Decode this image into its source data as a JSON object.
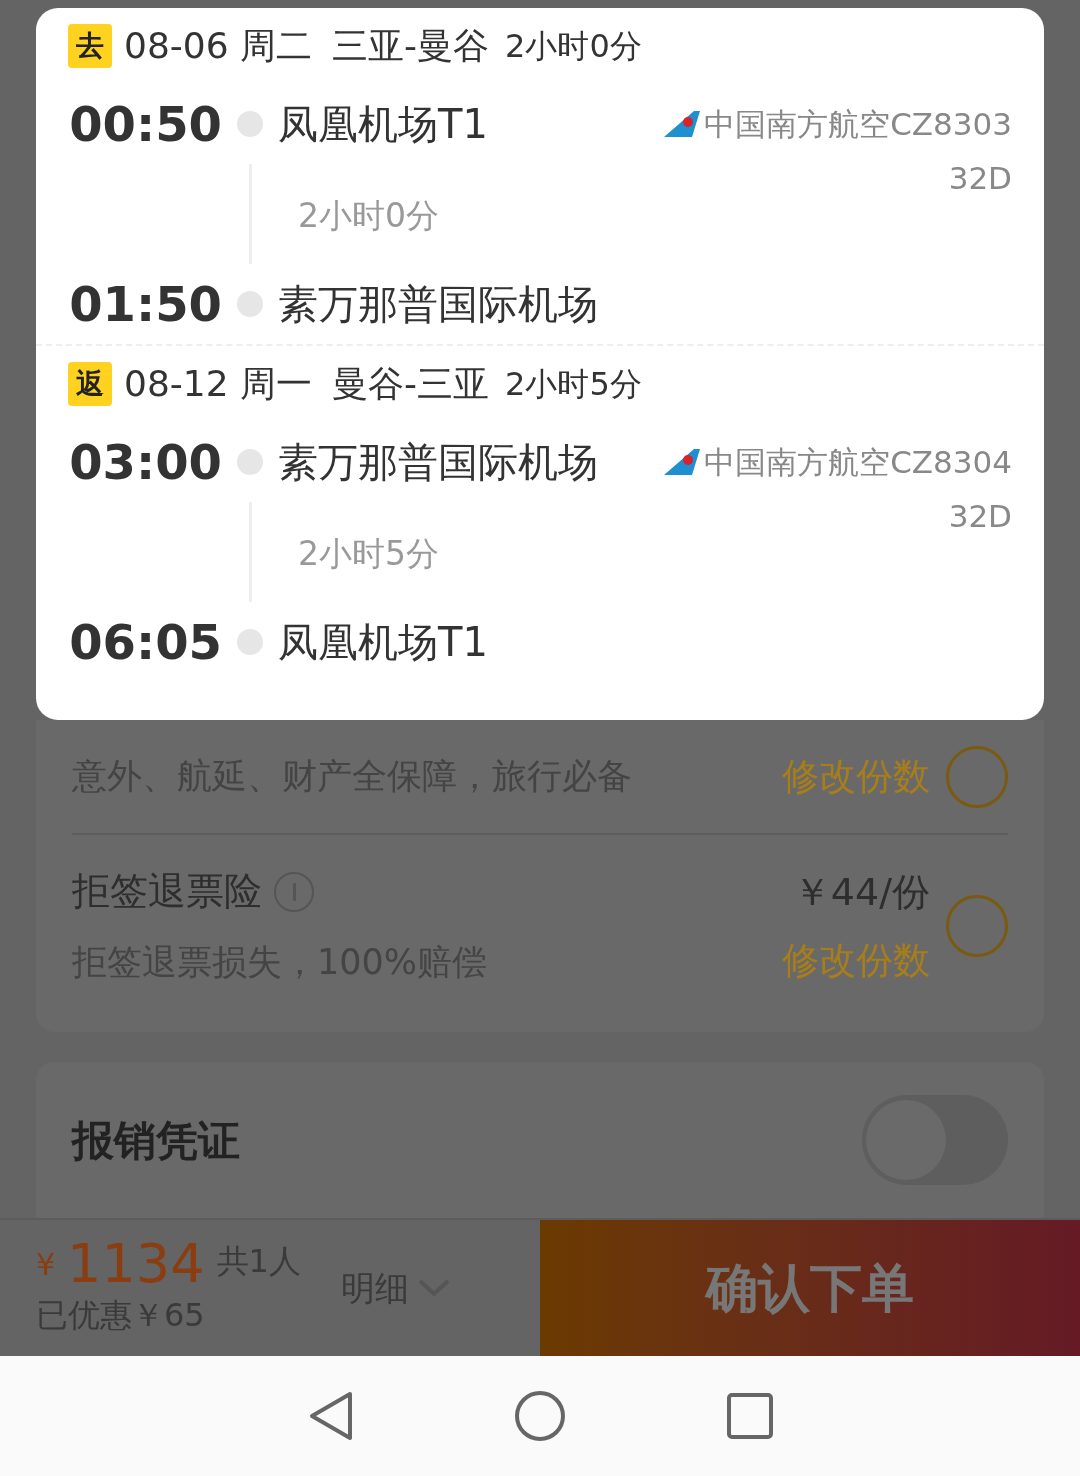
{
  "flights": [
    {
      "tag": "去",
      "date": "08-06 周二",
      "route": "三亚-曼谷",
      "duration": "2小时0分",
      "dep_time": "00:50",
      "dep_airport": "凤凰机场T1",
      "airline": "中国南方航空CZ8303",
      "seat": "32D",
      "leg_duration": "2小时0分",
      "arr_time": "01:50",
      "arr_airport": "素万那普国际机场"
    },
    {
      "tag": "返",
      "date": "08-12 周一",
      "route": "曼谷-三亚",
      "duration": "2小时5分",
      "dep_time": "03:00",
      "dep_airport": "素万那普国际机场",
      "airline": "中国南方航空CZ8304",
      "seat": "32D",
      "leg_duration": "2小时5分",
      "arr_time": "06:05",
      "arr_airport": "凤凰机场T1"
    }
  ],
  "insurance": [
    {
      "subtitle": "意外、航延、财产全保障，旅行必备",
      "action": "修改份数",
      "selected": false
    },
    {
      "title": "拒签退票险",
      "price": "￥44/份",
      "subtitle": "拒签退票损失，100%赔偿",
      "action": "修改份数",
      "selected": false
    }
  ],
  "invoice": {
    "label": "报销凭证",
    "on": false
  },
  "footer": {
    "currency": "¥",
    "price": "1134",
    "people": "共1人",
    "discount": "已优惠￥65",
    "details": "明细",
    "submit": "确认下单"
  }
}
